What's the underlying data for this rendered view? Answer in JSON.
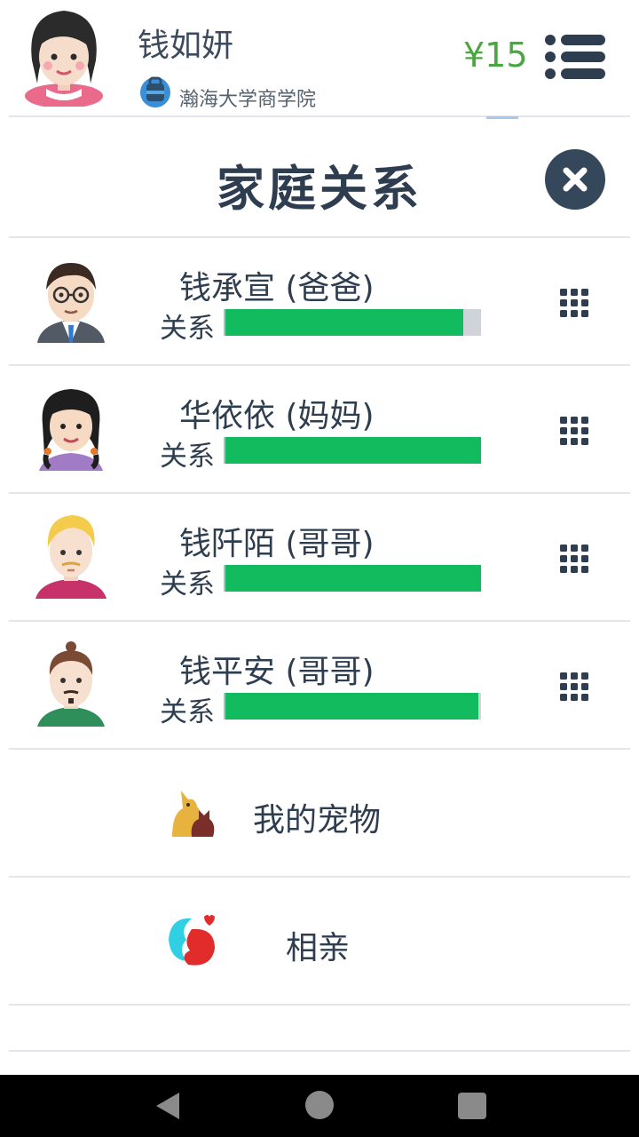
{
  "header": {
    "user_name": "钱如妍",
    "school": "瀚海大学商学院",
    "money": "¥15"
  },
  "title": "家庭关系",
  "family": [
    {
      "name": "钱承宣 (爸爸)",
      "relation_label": "关系",
      "relation_level": 0.93
    },
    {
      "name": "华依依 (妈妈)",
      "relation_label": "关系",
      "relation_level": 1.0
    },
    {
      "name": "钱阡陌 (哥哥)",
      "relation_label": "关系",
      "relation_level": 1.0
    },
    {
      "name": "钱平安 (哥哥)",
      "relation_label": "关系",
      "relation_level": 0.99
    }
  ],
  "menu": {
    "pets": "我的宠物",
    "dating": "相亲"
  },
  "colors": {
    "accent_dark": "#2e3e50",
    "money_green": "#4aa640",
    "bar_green": "#12bb5d",
    "bar_empty": "#cfd4da"
  }
}
